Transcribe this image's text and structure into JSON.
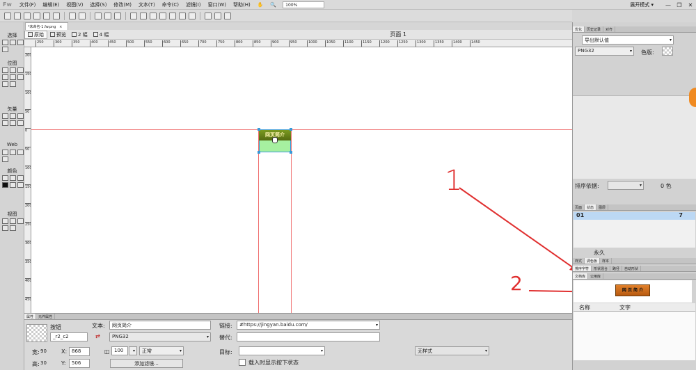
{
  "menubar": {
    "logo": "Fw",
    "items": [
      "文件(F)",
      "编辑(E)",
      "视图(V)",
      "选择(S)",
      "修改(M)",
      "文本(T)",
      "命令(C)",
      "滤镜(I)",
      "窗口(W)",
      "帮助(H)"
    ],
    "zoom": "100%",
    "workspace": "展开模式 ▾"
  },
  "document": {
    "tab_label": "*未命名-1.fw.png",
    "views": [
      "原始",
      "预览",
      "2 幅",
      "4 幅"
    ],
    "page_label": "页面 1",
    "ruler_h": [
      "250",
      "300",
      "350",
      "400",
      "450",
      "500",
      "550",
      "600",
      "650",
      "700",
      "750",
      "800",
      "850",
      "900",
      "950",
      "1000",
      "1050",
      "1100",
      "1150",
      "1200",
      "1250",
      "1300",
      "1350",
      "1400",
      "1450"
    ],
    "ruler_v": [
      "200",
      "150",
      "100",
      "50",
      "0",
      "50",
      "100",
      "150",
      "200",
      "250",
      "300",
      "350",
      "400",
      "450",
      "500"
    ],
    "annotation_1": "1",
    "annotation_2": "2",
    "button_text": "网页简介"
  },
  "tools": {
    "sections": [
      "选择",
      "位图",
      "矢量",
      "Web",
      "颜色",
      "视图"
    ]
  },
  "right_panel": {
    "optimize_tabs": [
      "优化",
      "历史记录",
      "对齐"
    ],
    "export_default": "导出默认值",
    "format": "PNG32",
    "palette_label": "色版:",
    "sort_label": "排序依据:",
    "color_count": "0 色",
    "pages_tabs": [
      "页面",
      "状态",
      "图层"
    ],
    "state_row": "01",
    "state_num": "7",
    "forever_label": "永久",
    "style_tabs_1": [
      "样式",
      "调色板",
      "样本"
    ],
    "style_tabs_2": [
      "排序字符",
      "形状混合",
      "路径",
      "自动形状"
    ],
    "library_tabs": [
      "文档库",
      "公用库"
    ],
    "library_preview": "网 页 简 介",
    "library_cols": [
      "名称",
      "文字"
    ]
  },
  "properties": {
    "tabs": [
      "属性",
      "元件属性"
    ],
    "type_label": "按钮",
    "instance_name": "_r2_c2",
    "text_label": "文本:",
    "text_value": "网页简介",
    "export_format": "PNG32",
    "link_label": "链接:",
    "link_value": "#https://jingyan.baidu.com/",
    "alt_label": "替代:",
    "alt_value": "",
    "target_label": "目标:",
    "target_value": "",
    "load_down_label": "载入时显示按下状态",
    "opacity": "100",
    "blend": "正常",
    "add_filter": "添加滤镜...",
    "style": "无样式",
    "w_label": "宽:",
    "w": "90",
    "h_label": "高:",
    "h": "30",
    "x_label": "X:",
    "x": "868",
    "y_label": "Y:",
    "y": "506"
  }
}
